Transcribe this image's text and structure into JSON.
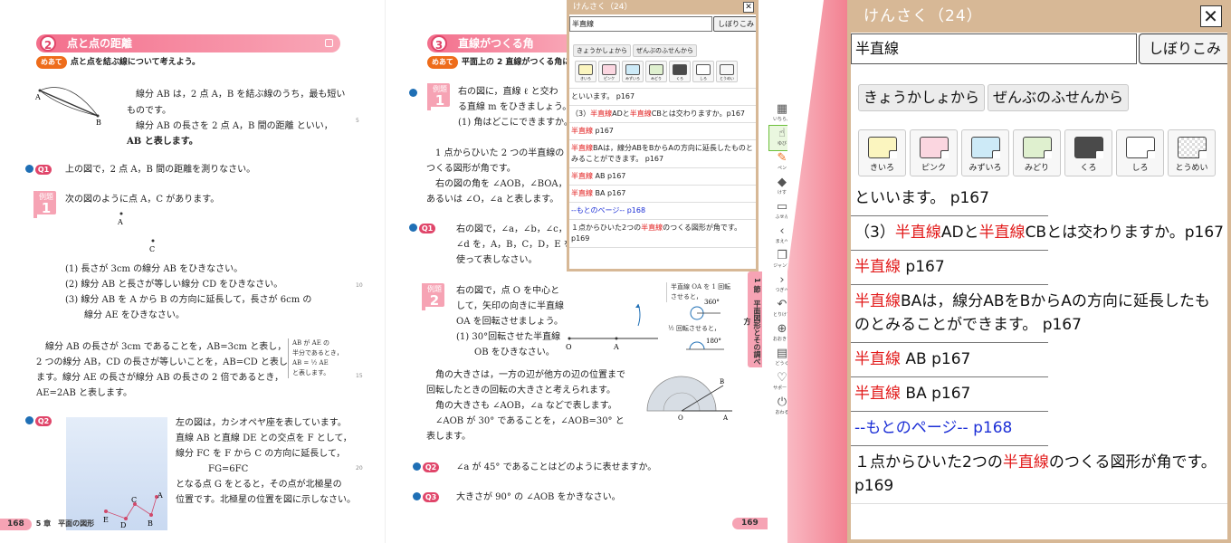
{
  "left_page": {
    "section_number": "2",
    "section_title": "点と点の距離",
    "ate_tag": "めあて",
    "ate_text": "点と点を結ぶ線について考えよう。",
    "diagram_labels": {
      "a": "A",
      "b": "B",
      "a2": "A",
      "c": "C"
    },
    "intro": [
      "線分 AB は，2 点 A，B を結ぶ線のうち，最も短い",
      "ものです。",
      "線分 AB の長さを 2 点 A，B 間の距離 といい，",
      "AB と表します。"
    ],
    "q1_label": "Q1",
    "q1_text": "上の図で，2 点 A，B 間の距離を測りなさい。",
    "rei_label": "例題",
    "rei_num": "1",
    "rei_text": "次の図のように点 A，C があります。",
    "rei_items": [
      "(1) 長さが 3cm の線分 AB をひきなさい。",
      "(2) 線分 AB と長さが等しい線分 CD をひきなさい。",
      "(3) 線分 AB を A から B の方向に延長して，長さが 6cm の",
      "線分 AE をひきなさい。"
    ],
    "body": [
      "線分 AB の長さが 3cm であることを，AB=3cm と表し，",
      "2 つの線分 AB，CD の長さが等しいことを，AB=CD と表し",
      "ます。線分 AE の長さが線分 AB の長さの 2 倍であるとき，",
      "AE=2AB と表します。"
    ],
    "note": [
      "AB が AE の",
      "半分であるとき，",
      "AB = ½ AE",
      "と表します。"
    ],
    "q2_label": "Q2",
    "q2_text": [
      "左の図は，カシオペヤ座を表しています。",
      "直線 AB と直線 DE との交点を F として，",
      "線分 FC を F から C の方向に延長して，",
      "FG=6FC",
      "となる点 G をとると，その点が北極星の",
      "位置です。北極星の位置を図に示しなさい。"
    ],
    "star_labels": [
      "A",
      "B",
      "C",
      "D",
      "E"
    ],
    "page_number": "168",
    "chapter": "5 章　平面の図形",
    "margin_numbers": [
      "5",
      "10",
      "15",
      "20"
    ]
  },
  "right_page": {
    "section_number": "3",
    "section_title": "直線がつくる角",
    "ate_tag": "めあて",
    "ate_text": "平面上の 2 直線がつくる角に",
    "rei_label": "例題",
    "rei_num": "1",
    "rei1": [
      "右の図に，直線 ℓ と交わ",
      "る直線 m をひきましょう。",
      "(1) 角はどこにできますか。"
    ],
    "body1": [
      "1 点からひいた 2 つの半直線の",
      "つくる図形が角です。",
      "右の図の角を ∠AOB，∠BOA，",
      "あるいは ∠O，∠a と表します。"
    ],
    "q1_label": "Q1",
    "q1": [
      "右の図で，∠a，∠b，∠c，",
      "∠d を，A，B，C，D，E を",
      "使って表しなさい。"
    ],
    "rei2_num": "2",
    "rei2": [
      "右の図で，点 O を中心と",
      "して，矢印の向きに半直線",
      "OA を回転させましょう。",
      "(1) 30°回転させた半直線",
      "OB をひきなさい。"
    ],
    "rot_notes": [
      "半直線 OA を 1 回転",
      "させると，",
      "360°",
      "½ 回転させると，",
      "180°"
    ],
    "diagram_labels": {
      "o": "O",
      "a": "A",
      "b": "B"
    },
    "body2": [
      "角の大きさは，一方の辺が他方の辺の位置まで",
      "回転したときの回転の大きさと考えられます。",
      "角の大きさも ∠AOB，∠a などで表します。",
      "∠AOB が 30° であることを，∠AOB=30° と",
      "表します。"
    ],
    "q2_label": "Q2",
    "q2": "∠a が 45° であることはどのように表せますか。",
    "q3_label": "Q3",
    "q3": "大きさが 90° の ∠AOB をかきなさい。",
    "side_tab": "1 節　平面図形とその調べ方",
    "page_number": "169"
  },
  "toolbar": [
    {
      "name": "grid",
      "glyph": "▦",
      "label": "いちらん"
    },
    {
      "name": "hand",
      "glyph": "☝",
      "label": "ゆび"
    },
    {
      "name": "pen",
      "glyph": "✎",
      "label": "ペン"
    },
    {
      "name": "eraser",
      "glyph": "◆",
      "label": "けす"
    },
    {
      "name": "sticky",
      "glyph": "▭",
      "label": "ふせん"
    },
    {
      "name": "prev",
      "glyph": "‹",
      "label": "まえへ"
    },
    {
      "name": "jump",
      "glyph": "❐",
      "label": "ジャンプ"
    },
    {
      "name": "next",
      "glyph": "›",
      "label": "つぎへ"
    },
    {
      "name": "undo",
      "glyph": "↶",
      "label": "とりけす"
    },
    {
      "name": "zoom",
      "glyph": "⊕",
      "label": "おおきさ"
    },
    {
      "name": "tools",
      "glyph": "▤",
      "label": "どうぐ"
    },
    {
      "name": "support",
      "glyph": "♡",
      "label": "サポート"
    },
    {
      "name": "power",
      "glyph": "⏻",
      "label": "おわる"
    }
  ],
  "search": {
    "title": "けんさく（24）",
    "query": "半直線",
    "filter_label": "しぼりこみ",
    "sources": [
      "きょうかしょから",
      "ぜんぶのふせんから"
    ],
    "colors": [
      {
        "label": "きいろ",
        "color": "#fbf5bf"
      },
      {
        "label": "ピンク",
        "color": "#fbd6e0"
      },
      {
        "label": "みずいろ",
        "color": "#cdeaf7"
      },
      {
        "label": "みどり",
        "color": "#dff0cf"
      },
      {
        "label": "くろ",
        "color": "#4a4a4a"
      },
      {
        "label": "しろ",
        "color": "#ffffff"
      },
      {
        "label": "とうめい",
        "color": "transparent"
      }
    ],
    "results": [
      {
        "pre": "といいます。 p167",
        "hl": "",
        "mid": "",
        "hl2": "",
        "post": ""
      },
      {
        "pre": "（3）",
        "hl": "半直線",
        "mid": "ADと",
        "hl2": "半直線",
        "post": "CBとは交わりますか。p167"
      },
      {
        "pre": "",
        "hl": "半直線",
        "mid": " p167",
        "hl2": "",
        "post": ""
      },
      {
        "pre": "",
        "hl": "半直線",
        "mid": "BAは，線分ABをBからAの方向に延長したものとみることができます。 p167",
        "hl2": "",
        "post": ""
      },
      {
        "pre": "",
        "hl": "半直線",
        "mid": " AB p167",
        "hl2": "",
        "post": ""
      },
      {
        "pre": "",
        "hl": "半直線",
        "mid": " BA p167",
        "hl2": "",
        "post": ""
      },
      {
        "back": "--もとのページ-- p168"
      },
      {
        "pre": "１点からひいた2つの",
        "hl": "半直線",
        "mid": "のつくる図形が角です。 p169",
        "hl2": "",
        "post": ""
      }
    ]
  },
  "colors": {
    "accent_pink": "#f36f8c",
    "panel_border": "#d7b896",
    "highlight": "#e21b1b",
    "link": "#1c2fd6"
  }
}
